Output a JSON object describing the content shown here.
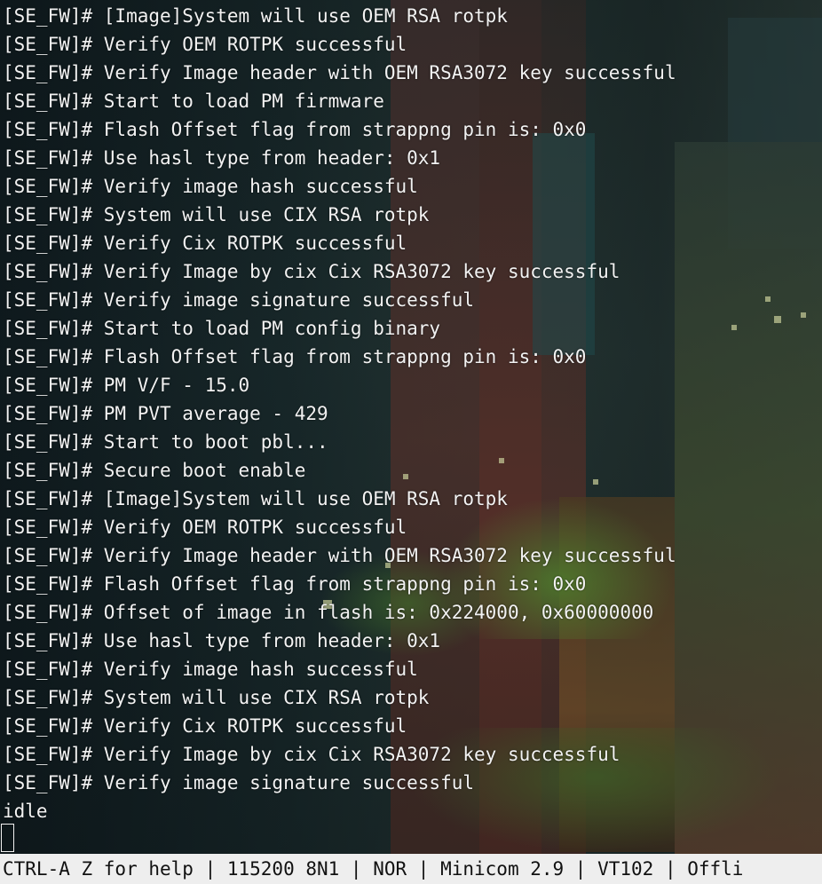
{
  "terminal": {
    "lines": [
      "[SE_FW]# [Image]System will use OEM RSA rotpk",
      "[SE_FW]# Verify OEM ROTPK successful",
      "[SE_FW]# Verify Image header with OEM RSA3072 key successful",
      "[SE_FW]# Start to load PM firmware",
      "[SE_FW]# Flash Offset flag from strappng pin is: 0x0",
      "[SE_FW]# Use hasl type from header: 0x1",
      "[SE_FW]# Verify image hash successful",
      "[SE_FW]# System will use CIX RSA rotpk",
      "[SE_FW]# Verify Cix ROTPK successful",
      "[SE_FW]# Verify Image by cix Cix RSA3072 key successful",
      "[SE_FW]# Verify image signature successful",
      "[SE_FW]# Start to load PM config binary",
      "[SE_FW]# Flash Offset flag from strappng pin is: 0x0",
      "[SE_FW]# PM V/F - 15.0",
      "[SE_FW]# PM PVT average - 429",
      "[SE_FW]# Start to boot pbl...",
      "[SE_FW]# Secure boot enable",
      "[SE_FW]# [Image]System will use OEM RSA rotpk",
      "[SE_FW]# Verify OEM ROTPK successful",
      "[SE_FW]# Verify Image header with OEM RSA3072 key successful",
      "[SE_FW]# Flash Offset flag from strappng pin is: 0x0",
      "[SE_FW]# Offset of image in flash is: 0x224000, 0x60000000",
      "[SE_FW]# Use hasl type from header: 0x1",
      "[SE_FW]# Verify image hash successful",
      "[SE_FW]# System will use CIX RSA rotpk",
      "[SE_FW]# Verify Cix ROTPK successful",
      "[SE_FW]# Verify Image by cix Cix RSA3072 key successful",
      "[SE_FW]# Verify image signature successful",
      "idle"
    ]
  },
  "statusbar": {
    "text": "CTRL-A Z for help | 115200 8N1 | NOR | Minicom 2.9 | VT102 | Offli"
  },
  "colors": {
    "text": "#f2f2f2",
    "statusbar_bg": "#eeeeee",
    "statusbar_text": "#111111"
  }
}
